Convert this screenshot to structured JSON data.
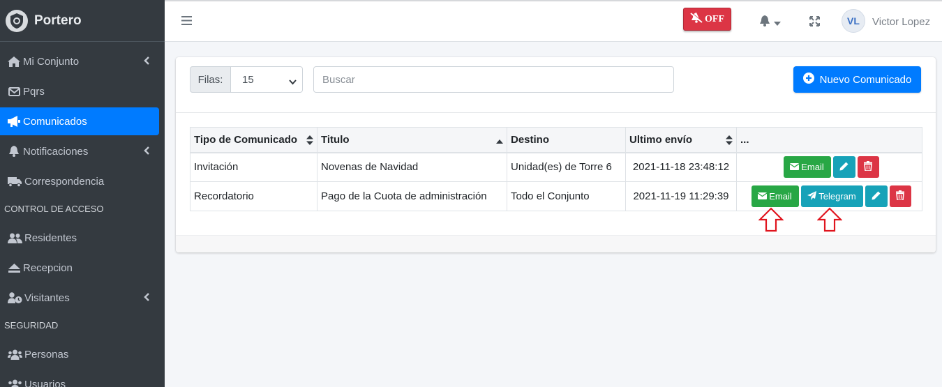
{
  "brand": {
    "name": "Portero"
  },
  "sidebar": {
    "items": [
      {
        "label": "Mi Conjunto",
        "icon": "home-icon",
        "chevron": true
      },
      {
        "label": "Pqrs",
        "icon": "envelope-icon",
        "chevron": false
      },
      {
        "label": "Comunicados",
        "icon": "megaphone-icon",
        "chevron": false,
        "active": true
      },
      {
        "label": "Notificaciones",
        "icon": "bell-icon",
        "chevron": true
      },
      {
        "label": "Correspondencia",
        "icon": "truck-icon",
        "chevron": false
      }
    ],
    "header_access": "CONTROL DE ACCESO",
    "access_items": [
      {
        "label": "Residentes",
        "icon": "users-icon"
      },
      {
        "label": "Recepcion",
        "icon": "eject-icon"
      },
      {
        "label": "Visitantes",
        "icon": "user-clock-icon",
        "chevron": true
      }
    ],
    "header_security": "SEGURIDAD",
    "security_items": [
      {
        "label": "Personas",
        "icon": "users-group-icon"
      },
      {
        "label": "Usuarios",
        "icon": "users-group-icon"
      }
    ]
  },
  "topbar": {
    "off_label": "OFF",
    "avatar_initials": "VL",
    "username": "Victor Lopez"
  },
  "toolbar": {
    "filas_label": "Filas:",
    "filas_value": "15",
    "search_placeholder": "Buscar",
    "new_button": "Nuevo Comunicado"
  },
  "table": {
    "headers": [
      "Tipo de Comunicado",
      "Titulo",
      "Destino",
      "Ultimo envío",
      "..."
    ],
    "rows": [
      {
        "tipo": "Invitación",
        "titulo": "Novenas de Navidad",
        "destino": "Unidad(es) de Torre 6",
        "envio": "2021-11-18 23:48:12"
      },
      {
        "tipo": "Recordatorio",
        "titulo": "Pago de la Cuota de administración",
        "destino": "Todo el Conjunto",
        "envio": "2021-11-19 11:29:39"
      }
    ],
    "email_label": "Email",
    "telegram_label": "Telegram"
  },
  "colors": {
    "primary": "#007bff",
    "success": "#28a745",
    "info": "#17a2b8",
    "danger": "#dc3545",
    "sidebar": "#343a40"
  }
}
